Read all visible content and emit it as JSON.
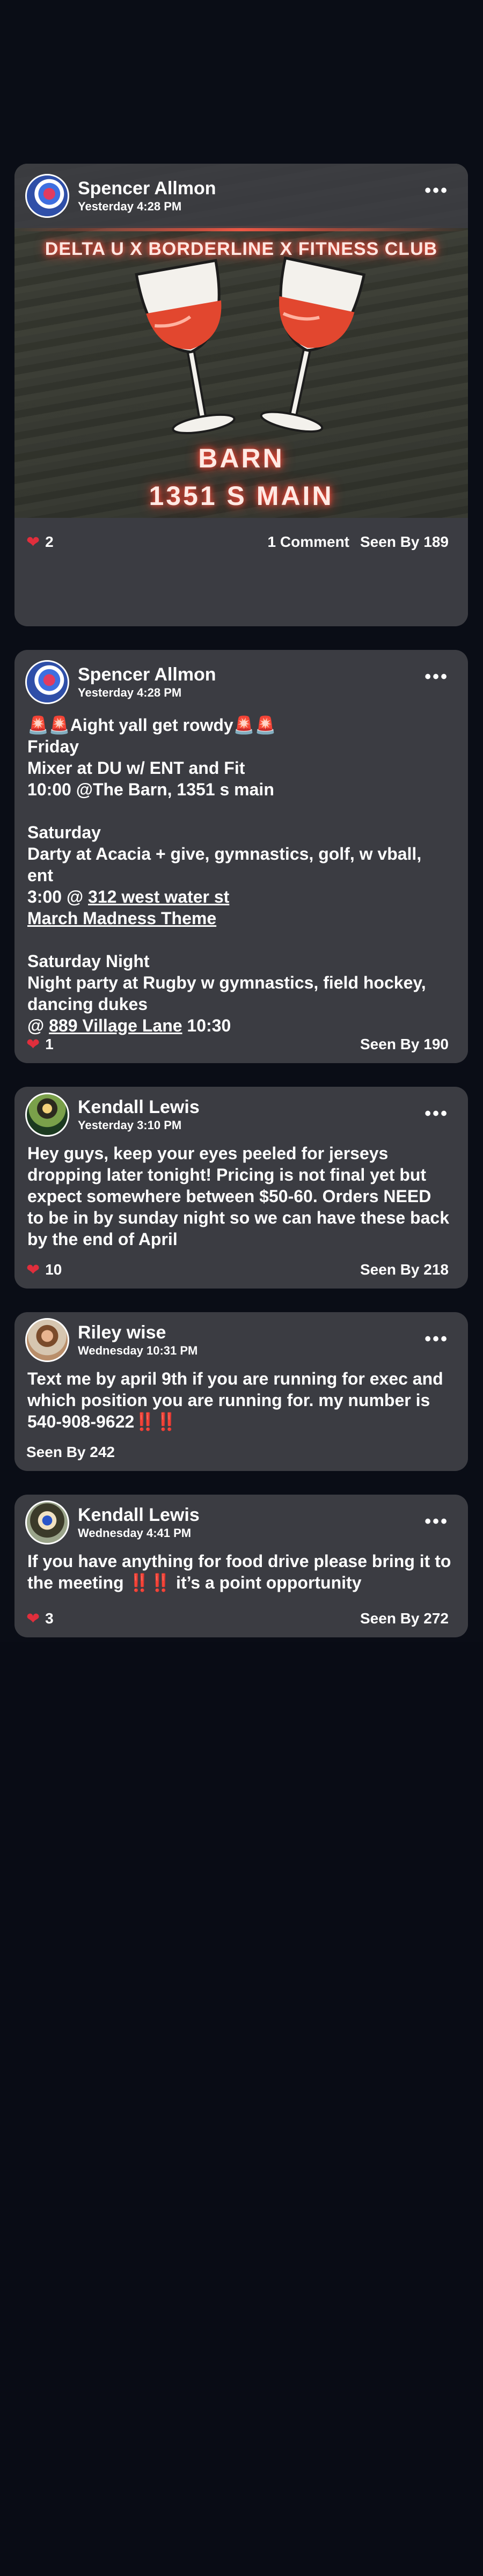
{
  "posts": [
    {
      "author": "Spencer Allmon",
      "time": "Yesterday 4:28 PM",
      "poster": {
        "headline": "DELTA U X BORDERLINE X FITNESS CLUB",
        "line1": "BARN",
        "line2": "1351 S MAIN"
      },
      "likes": "2",
      "comments": "1 Comment",
      "seen": "Seen By 189"
    },
    {
      "author": "Spencer Allmon",
      "time": "Yesterday 4:28 PM",
      "lines": {
        "l1": "Aight yall get rowdy",
        "l2": "Friday",
        "l3": "Mixer at DU w/ ENT and Fit",
        "l4": "10:00 @The Barn, 1351 s main",
        "l5": "Saturday",
        "l6": "Darty at Acacia + give, gymnastics, golf, w vball, ent",
        "l7_prefix": "3:00 @ ",
        "l7_link": "312 west water st",
        "l8": "March Madness Theme",
        "l9": "Saturday Night",
        "l10": "Night party at Rugby w gymnastics, field hockey, dancing dukes",
        "l11_prefix": "@ ",
        "l11_link": "889 Village Lane",
        "l11_suffix": " 10:30"
      },
      "likes": "1",
      "seen": "Seen By 190"
    },
    {
      "author": "Kendall Lewis",
      "time": "Yesterday 3:10 PM",
      "text": "Hey guys, keep your eyes peeled for jerseys dropping later tonight! Pricing is not final yet but expect somewhere between $50-60. Orders NEED to be in by sunday night so we can have these back by the end of April",
      "likes": "10",
      "seen": "Seen By 218"
    },
    {
      "author": "Riley wise",
      "time": "Wednesday 10:31 PM",
      "text": "Text me by april 9th if you are running for exec and which position you are running for. my number is 540-908-9622",
      "seen": "Seen By 242"
    },
    {
      "author": "Kendall Lewis",
      "time": "Wednesday 4:41 PM",
      "text_a": "If you have anything for food drive please bring it to the meeting ",
      "text_b": " it’s a point opportunity",
      "likes": "3",
      "seen": "Seen By 272"
    }
  ],
  "icons": {
    "more": "ellipsis-icon",
    "heart": "heart-icon",
    "siren": "siren-emoji",
    "bang": "double-exclamation-emoji"
  }
}
